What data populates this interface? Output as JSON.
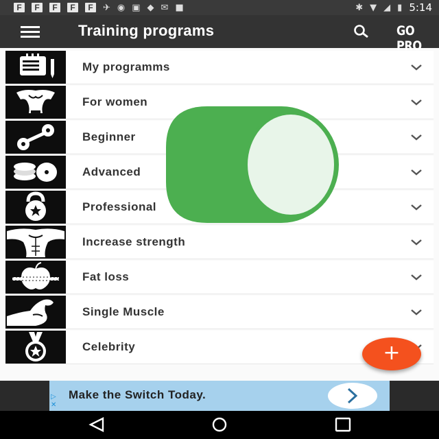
{
  "status_bar": {
    "notification_icons": [
      "F",
      "F",
      "F",
      "F",
      "F"
    ],
    "time": "5:14"
  },
  "app_bar": {
    "title": "Training programs",
    "go_pro": "GO PRO"
  },
  "programs": [
    {
      "label": "My programms",
      "icon": "notepad-icon"
    },
    {
      "label": "For women",
      "icon": "female-torso-icon"
    },
    {
      "label": "Beginner",
      "icon": "dumbbell-icon"
    },
    {
      "label": "Advanced",
      "icon": "weight-plates-icon"
    },
    {
      "label": "Professional",
      "icon": "kettlebell-icon"
    },
    {
      "label": "Increase strength",
      "icon": "male-torso-icon"
    },
    {
      "label": "Fat loss",
      "icon": "apple-tape-icon"
    },
    {
      "label": "Single Muscle",
      "icon": "biceps-icon"
    },
    {
      "label": "Celebrity",
      "icon": "star-medal-icon"
    }
  ],
  "fab": {
    "label": "+"
  },
  "ad": {
    "text": "Make the Switch Today."
  },
  "colors": {
    "app_bar": "#333333",
    "fab": "#f4511e",
    "overlay_green": "#4caf50",
    "ad_background": "#a6d1ed"
  }
}
